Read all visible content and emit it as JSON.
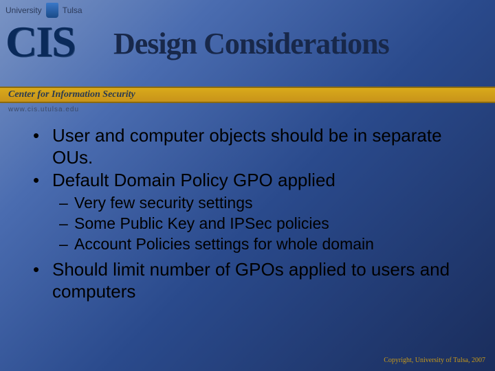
{
  "header": {
    "university_left": "University",
    "university_right": "Tulsa",
    "logo_text": "CIS",
    "center_name": "Center for Information Security",
    "url": "www.cis.utulsa.edu"
  },
  "title": "Design Considerations",
  "bullets": [
    {
      "text": "User and computer objects should be in separate OUs.",
      "subs": []
    },
    {
      "text": "Default Domain Policy GPO applied",
      "subs": [
        "Very few security settings",
        "Some Public Key and IPSec policies",
        "Account Policies settings for whole domain"
      ]
    },
    {
      "text": "Should limit number of GPOs applied to users and computers",
      "subs": []
    }
  ],
  "copyright": "Copyright, University of Tulsa, 2007"
}
